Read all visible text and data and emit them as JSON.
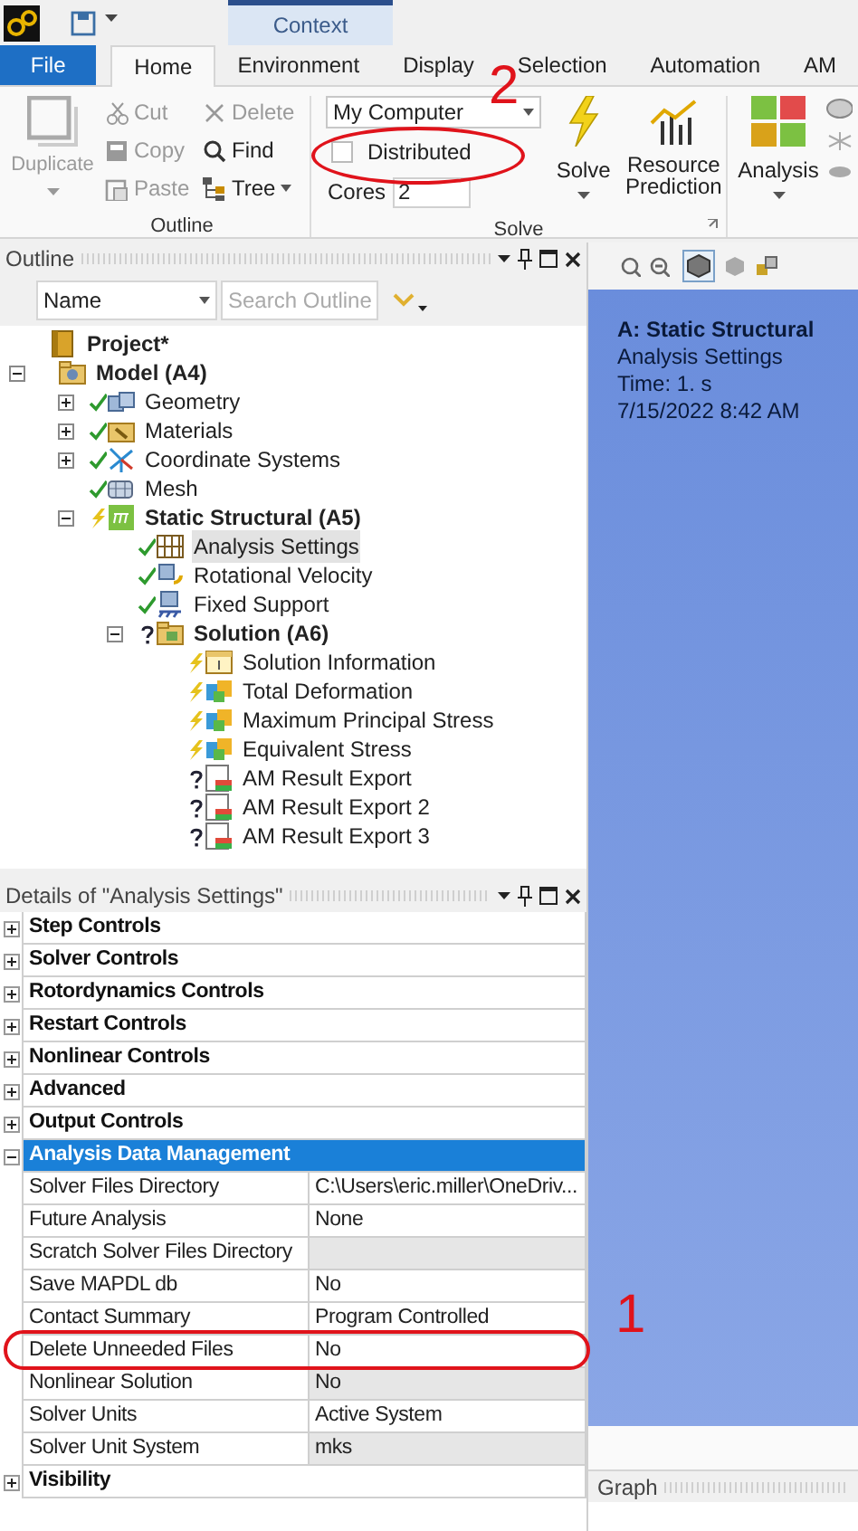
{
  "title_bar": {
    "contextual_tab": "Context"
  },
  "ribbon_tabs": [
    {
      "label": "File",
      "kind": "file",
      "selected": false
    },
    {
      "label": "Home",
      "kind": "tab",
      "selected": true
    },
    {
      "label": "Environment",
      "kind": "tab",
      "selected": false
    },
    {
      "label": "Display",
      "kind": "tab",
      "selected": false
    },
    {
      "label": "Selection",
      "kind": "tab",
      "selected": false
    },
    {
      "label": "Automation",
      "kind": "tab",
      "selected": false
    },
    {
      "label": "AM",
      "kind": "tab",
      "selected": false
    }
  ],
  "outline_group": {
    "title": "Outline",
    "large_button": {
      "label": "Duplicate",
      "disabled": true
    },
    "small_buttons": [
      {
        "label": "Cut",
        "kind": "cut",
        "disabled": true
      },
      {
        "label": "Copy",
        "kind": "copy",
        "disabled": true
      },
      {
        "label": "Paste",
        "kind": "paste",
        "disabled": true
      },
      {
        "label": "Delete",
        "kind": "delete",
        "disabled": true
      },
      {
        "label": "Find",
        "kind": "find",
        "disabled": false
      },
      {
        "label": "Tree",
        "kind": "tree",
        "disabled": false
      }
    ]
  },
  "solve_group": {
    "title": "Solve",
    "solver_target": "My Computer",
    "distributed": {
      "label": "Distributed",
      "checked": false
    },
    "cores_label": "Cores",
    "cores_value": "2",
    "solve_button": "Solve",
    "prediction_button": "Resource Prediction"
  },
  "analysis_button": "Analysis",
  "outline": {
    "title": "Outline",
    "filter": "Name",
    "search": {
      "placeholder": "Search Outline"
    },
    "tree": [
      {
        "label": "Project*",
        "kind": "project",
        "selected": false
      },
      {
        "label": "Model (A4)",
        "kind": "model",
        "expanded": true,
        "selected": false,
        "children": [
          {
            "label": "Geometry",
            "kind": "geometry",
            "status": {
              "kind": "ok"
            },
            "expanded": false,
            "selected": false
          },
          {
            "label": "Materials",
            "kind": "materials",
            "status": {
              "kind": "ok"
            },
            "expanded": false,
            "selected": false
          },
          {
            "label": "Coordinate Systems",
            "kind": "coordinates",
            "status": {
              "kind": "ok"
            },
            "expanded": false,
            "selected": false
          },
          {
            "label": "Mesh",
            "kind": "mesh",
            "status": {
              "kind": "ok"
            },
            "selected": false
          },
          {
            "label": "Static Structural (A5)",
            "kind": "environment",
            "status": {
              "kind": "pending"
            },
            "expanded": true,
            "selected": false,
            "children": [
              {
                "label": "Analysis Settings",
                "kind": "settings",
                "status": {
                  "kind": "ok"
                },
                "selected": true
              },
              {
                "label": "Rotational Velocity",
                "kind": "velocity",
                "status": {
                  "kind": "ok"
                },
                "selected": false
              },
              {
                "label": "Fixed Support",
                "kind": "support",
                "status": {
                  "kind": "ok"
                },
                "selected": false
              },
              {
                "label": "Solution (A6)",
                "kind": "solution",
                "status": {
                  "kind": "unknown"
                },
                "expanded": true,
                "selected": false,
                "children": [
                  {
                    "label": "Solution Information",
                    "kind": "info",
                    "status": {
                      "kind": "pending"
                    },
                    "selected": false
                  },
                  {
                    "label": "Total Deformation",
                    "kind": "result",
                    "status": {
                      "kind": "pending"
                    },
                    "selected": false
                  },
                  {
                    "label": "Maximum Principal Stress",
                    "kind": "result",
                    "status": {
                      "kind": "pending"
                    },
                    "selected": false
                  },
                  {
                    "label": "Equivalent Stress",
                    "kind": "result",
                    "status": {
                      "kind": "pending"
                    },
                    "selected": false
                  },
                  {
                    "label": "AM Result Export",
                    "kind": "export",
                    "status": {
                      "kind": "unknown"
                    },
                    "selected": false
                  },
                  {
                    "label": "AM Result Export 2",
                    "kind": "export",
                    "status": {
                      "kind": "unknown"
                    },
                    "selected": false
                  },
                  {
                    "label": "AM Result Export 3",
                    "kind": "export",
                    "status": {
                      "kind": "unknown"
                    },
                    "selected": false
                  }
                ]
              }
            ]
          }
        ]
      }
    ]
  },
  "details": {
    "title": "Details of \"Analysis Settings\"",
    "sections": [
      {
        "label": "Step Controls",
        "expanded": false,
        "selected": false
      },
      {
        "label": "Solver Controls",
        "expanded": false,
        "selected": false
      },
      {
        "label": "Rotordynamics Controls",
        "expanded": false,
        "selected": false
      },
      {
        "label": "Restart Controls",
        "expanded": false,
        "selected": false
      },
      {
        "label": "Nonlinear Controls",
        "expanded": false,
        "selected": false
      },
      {
        "label": "Advanced",
        "expanded": false,
        "selected": false
      },
      {
        "label": "Output Controls",
        "expanded": false,
        "selected": false
      },
      {
        "label": "Analysis Data Management",
        "expanded": true,
        "selected": true,
        "rows": [
          {
            "label": "Solver Files Directory",
            "value": "C:\\Users\\eric.miller\\OneDriv...",
            "readonly": false
          },
          {
            "label": "Future Analysis",
            "value": "None",
            "readonly": false
          },
          {
            "label": "Scratch Solver Files Directory",
            "readonly": true
          },
          {
            "label": "Save MAPDL db",
            "value": "No",
            "readonly": false
          },
          {
            "label": "Contact Summary",
            "value": "Program Controlled",
            "readonly": false
          },
          {
            "label": "Delete Unneeded Files",
            "value": "No",
            "readonly": false
          },
          {
            "label": "Nonlinear Solution",
            "value": "No",
            "readonly": true
          },
          {
            "label": "Solver Units",
            "value": "Active System",
            "readonly": false
          },
          {
            "label": "Solver Unit System",
            "value": "mks",
            "readonly": true
          }
        ]
      },
      {
        "label": "Visibility",
        "expanded": false,
        "selected": false
      }
    ]
  },
  "viewport": {
    "title": "A: Static Structural",
    "lines": [
      "Analysis Settings",
      "Time: 1. s",
      "7/15/2022 8:42 AM"
    ]
  },
  "graph_panel": {
    "title": "Graph"
  },
  "annotations": [
    {
      "text": "2"
    },
    {
      "text": "1"
    }
  ]
}
